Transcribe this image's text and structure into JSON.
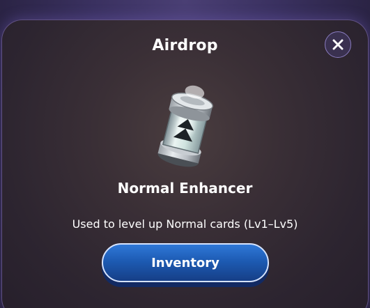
{
  "modal": {
    "title": "Airdrop",
    "item": {
      "name": "Normal Enhancer",
      "description": "Used to level up Normal cards (Lv1–Lv5)",
      "icon": "enhancer-canister-icon"
    },
    "close": {
      "icon": "close-icon"
    },
    "inventory_button_label": "Inventory"
  },
  "colors": {
    "backdrop": "#2b2445",
    "modal_bg": "#3a2f36",
    "modal_border": "#8c78c8",
    "button_blue": "#1d5bb3",
    "button_border": "#d6e4ff",
    "text": "#ffffff"
  }
}
